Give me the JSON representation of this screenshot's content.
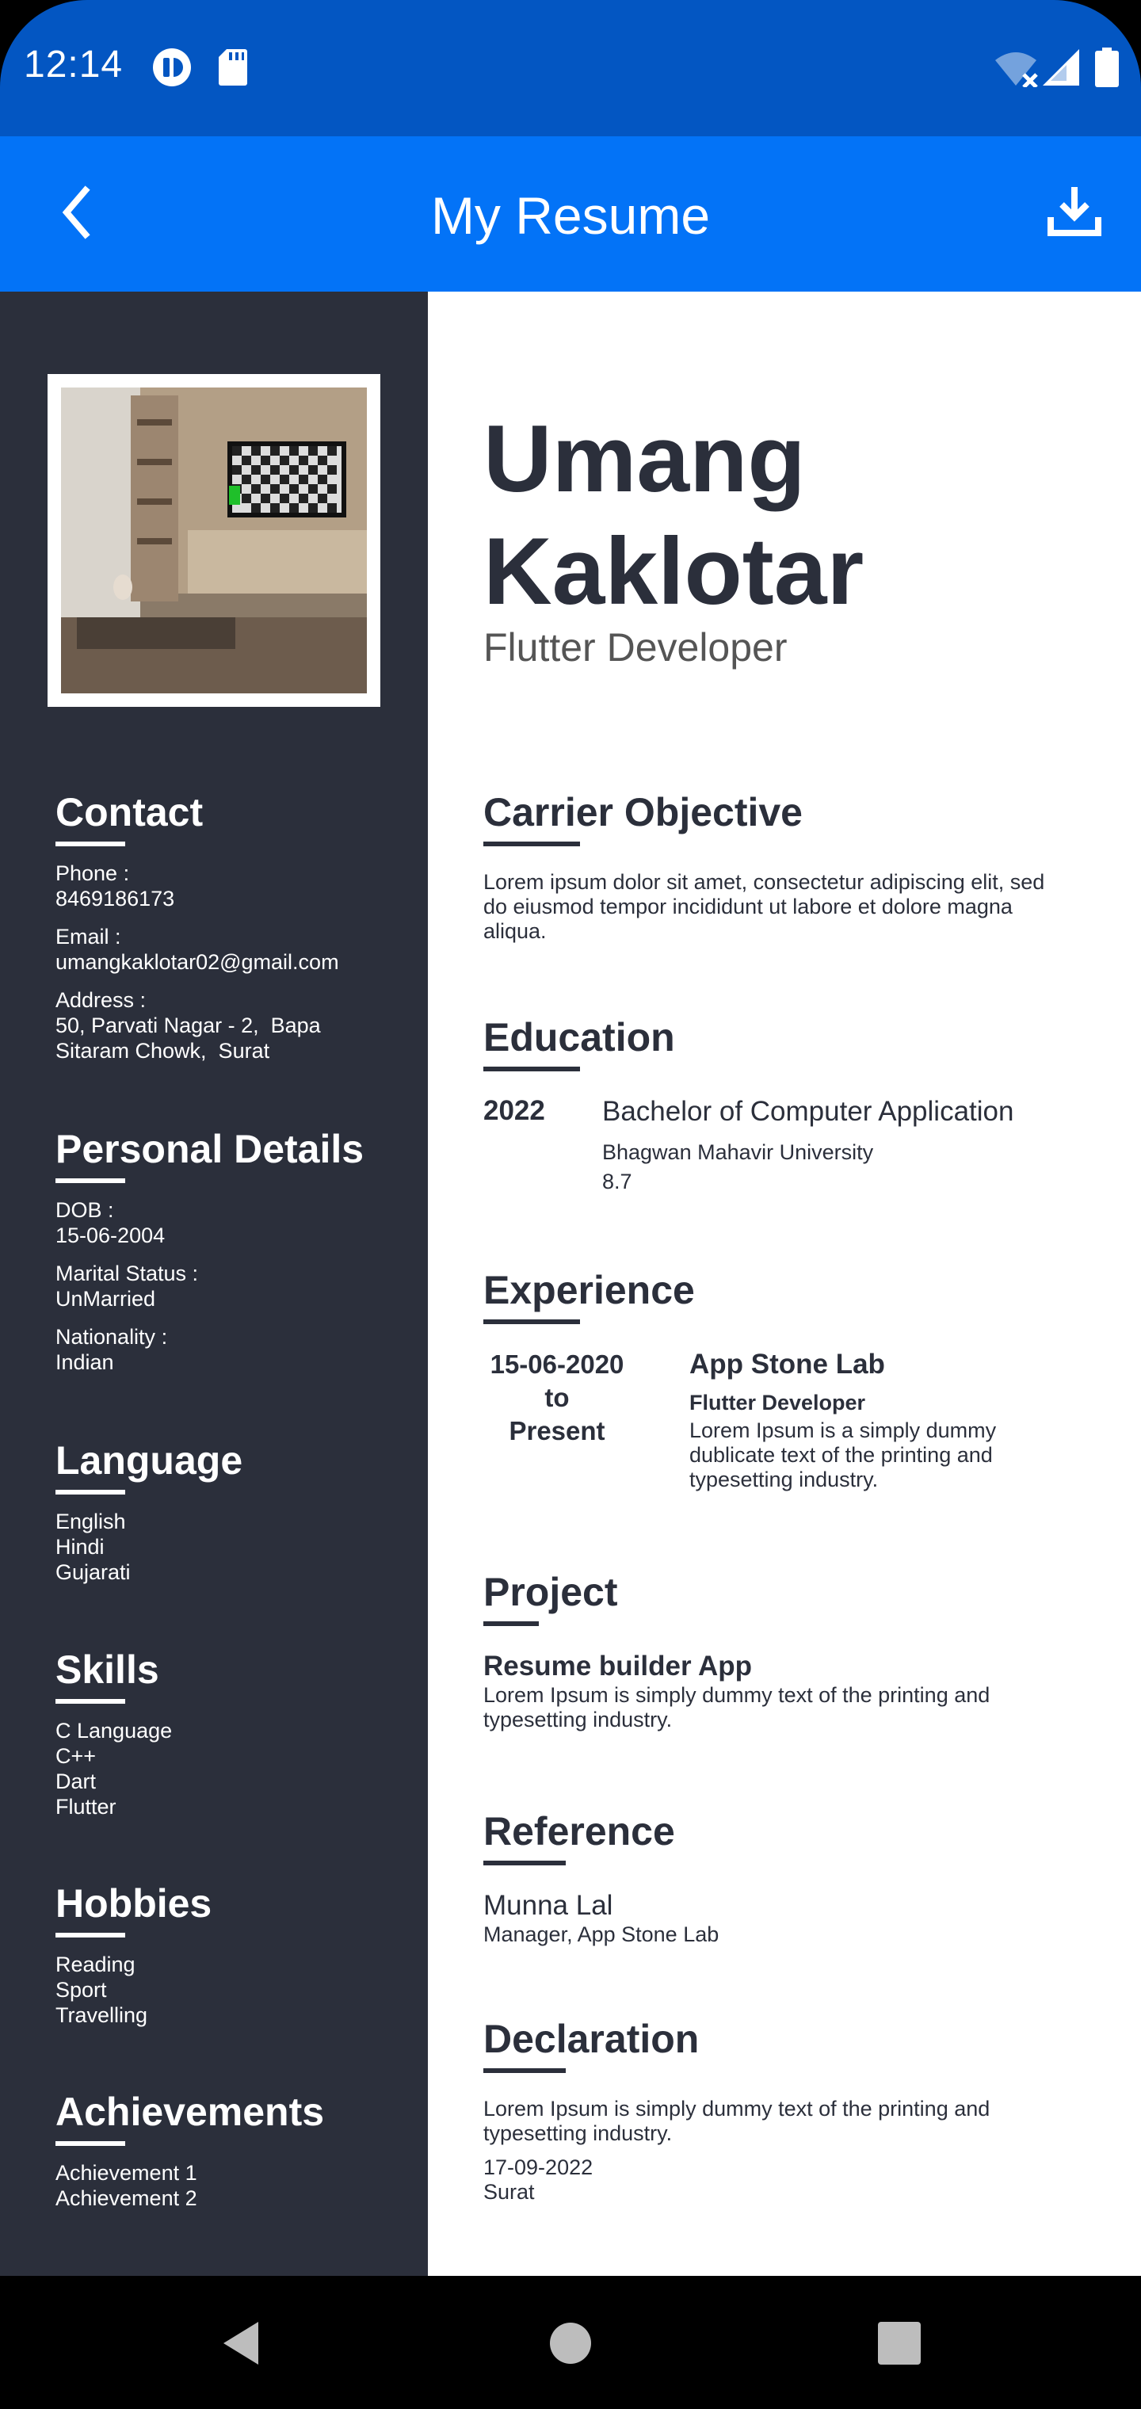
{
  "status_bar": {
    "time": "12:14"
  },
  "app_bar": {
    "title": "My Resume"
  },
  "profile": {
    "name_line1": "Umang",
    "name_line2": "Kaklotar",
    "role": "Flutter Developer"
  },
  "sidebar": {
    "contact": {
      "heading": "Contact",
      "phone_label": "Phone :",
      "phone": "8469186173",
      "email_label": "Email :",
      "email": "umangkaklotar02@gmail.com",
      "address_label": "Address :",
      "address_line1": "50, Parvati Nagar - 2,  Bapa",
      "address_line2": "Sitaram Chowk,  Surat"
    },
    "personal": {
      "heading": "Personal Details",
      "dob_label": "DOB :",
      "dob": "15-06-2004",
      "marital_label": "Marital Status :",
      "marital": "UnMarried",
      "nationality_label": "Nationality :",
      "nationality": "Indian"
    },
    "language": {
      "heading": "Language",
      "items": [
        "English",
        "Hindi",
        "Gujarati"
      ]
    },
    "skills": {
      "heading": "Skills",
      "items": [
        "C Language",
        "C++",
        "Dart",
        "Flutter"
      ]
    },
    "hobbies": {
      "heading": "Hobbies",
      "items": [
        "Reading",
        "Sport",
        "Travelling"
      ]
    },
    "achievements": {
      "heading": "Achievements",
      "items": [
        "Achievement 1",
        "Achievement 2"
      ]
    }
  },
  "main": {
    "objective": {
      "heading": "Carrier Objective",
      "line1": "Lorem ipsum dolor sit amet, consectetur adipiscing elit, sed",
      "line2": "do eiusmod tempor incididunt ut labore et dolore magna",
      "line3": "aliqua."
    },
    "education": {
      "heading": "Education",
      "year": "2022",
      "degree": "Bachelor of Computer Application",
      "university": "Bhagwan Mahavir University",
      "score": "8.7"
    },
    "experience": {
      "heading": "Experience",
      "date_from": "15-06-2020",
      "date_to_word": "to",
      "date_to": "Present",
      "company": "App Stone Lab",
      "position": "Flutter Developer",
      "line1": "Lorem Ipsum is a simply dummy",
      "line2": "dublicate text of the printing and",
      "line3": "typesetting industry."
    },
    "project": {
      "heading": "Project",
      "title": "Resume builder App",
      "line1": "Lorem Ipsum is simply dummy text of the printing and",
      "line2": "typesetting industry."
    },
    "reference": {
      "heading": "Reference",
      "name": "Munna Lal",
      "designation": "Manager, App Stone Lab"
    },
    "declaration": {
      "heading": "Declaration",
      "line1": "Lorem Ipsum is simply dummy text of the printing and",
      "line2": "typesetting industry.",
      "date": "17-09-2022",
      "place": "Surat"
    }
  },
  "colors": {
    "status_bar": "#0356C2",
    "app_bar": "#0373F7",
    "sidebar": "#2B2F3B",
    "text_dark": "#2B2F3B"
  },
  "icons": [
    "back-arrow-icon",
    "download-icon",
    "wifi-off-icon",
    "signal-icon",
    "battery-icon",
    "sd-card-icon",
    "notification-app-icon"
  ]
}
